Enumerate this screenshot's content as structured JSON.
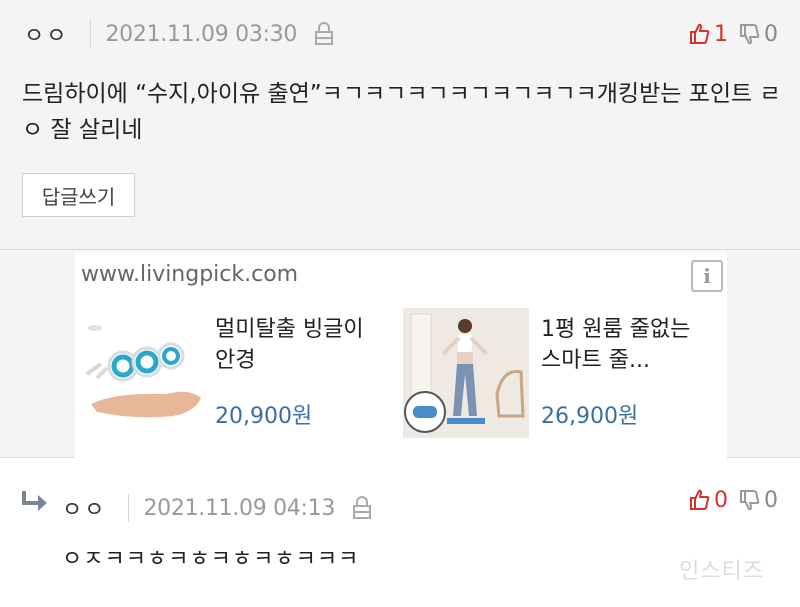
{
  "comment1": {
    "nickname": "ㅇㅇ",
    "date": "2021.11.09 03:30",
    "likes": "1",
    "dislikes": "0",
    "text": "드림하이에 “수지,아이유 출연”ㅋㄱㅋㄱㅋㄱㅋㄱㅋㄱㅋㄱㅋ개킹받는 포인트 ㄹㅇ 잘 살리네",
    "reply_button": "답글쓰기"
  },
  "ad": {
    "domain": "www.livingpick.com",
    "info_label": "i",
    "products": [
      {
        "title": "멀미탈출 빙글이 안경",
        "price": "20,900원",
        "image": "motion-sickness-glasses"
      },
      {
        "title": "1평 원룸 줄없는 스마트 줄...",
        "price": "26,900원",
        "image": "smart-jump-rope"
      }
    ]
  },
  "comment2": {
    "nickname": "ㅇㅇ",
    "date": "2021.11.09 04:13",
    "likes": "0",
    "dislikes": "0",
    "text": "ㅇㅈㅋㅋㅎㅋㅎㅋㅎㅋㅎㅋㅋㅋ"
  },
  "watermark": "인스티즈",
  "colors": {
    "like": "#d0342c",
    "dislike": "#888888",
    "price": "#3a6ea5",
    "background": "#f4f4f4"
  },
  "icons": [
    "lock-icon",
    "thumbs-up-icon",
    "thumbs-down-icon",
    "info-icon",
    "reply-arrow-icon"
  ]
}
